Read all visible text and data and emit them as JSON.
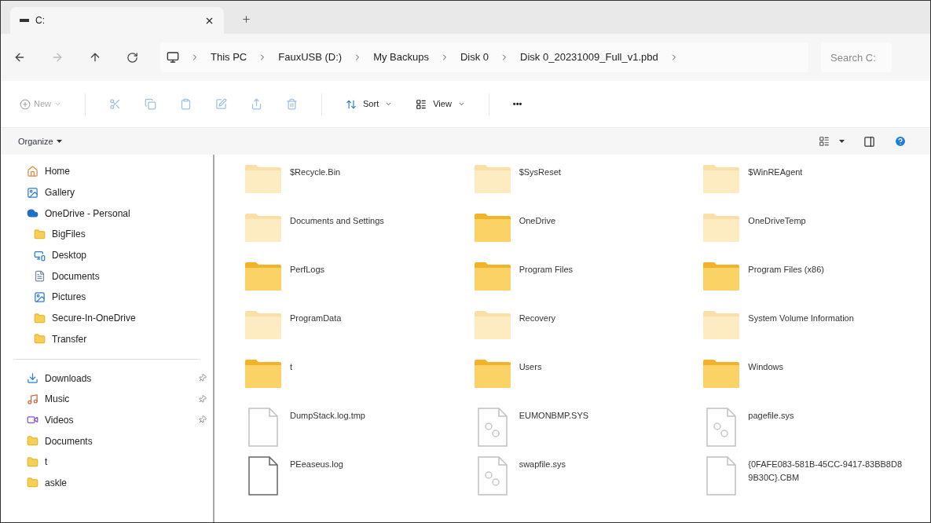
{
  "tab": {
    "title": "C:",
    "selected": true
  },
  "address": {
    "crumbs": [
      "This PC",
      "FauxUSB (D:)",
      "My Backups",
      "Disk 0",
      "Disk 0_20231009_Full_v1.pbd"
    ],
    "search_placeholder": "Search C:"
  },
  "toolbar": {
    "new": {
      "label": "New",
      "disabled": true
    },
    "actions": [
      {
        "kind": "cut",
        "disabled": true
      },
      {
        "kind": "copy",
        "disabled": true
      },
      {
        "kind": "paste",
        "disabled": true
      },
      {
        "kind": "rename",
        "disabled": true
      },
      {
        "kind": "share",
        "disabled": true
      },
      {
        "kind": "delete",
        "disabled": true
      }
    ],
    "sort": "Sort",
    "view": "View",
    "more": "•••"
  },
  "organize": "Organize",
  "sidebar": {
    "groups": [
      [
        {
          "label": "Home",
          "kind": "home"
        },
        {
          "label": "Gallery",
          "kind": "gallery"
        },
        {
          "label": "OneDrive - Personal",
          "kind": "cloud",
          "children": [
            {
              "label": "BigFiles",
              "kind": "folder"
            },
            {
              "label": "Desktop",
              "kind": "desktop"
            },
            {
              "label": "Documents",
              "kind": "documents"
            },
            {
              "label": "Pictures",
              "kind": "gallery"
            },
            {
              "label": "Secure-In-OneDrive",
              "kind": "folder"
            },
            {
              "label": "Transfer",
              "kind": "folder"
            }
          ]
        }
      ],
      [
        {
          "label": "Downloads",
          "kind": "download",
          "pinned": true
        },
        {
          "label": "Music",
          "kind": "music",
          "pinned": true
        },
        {
          "label": "Videos",
          "kind": "video",
          "pinned": true
        },
        {
          "label": "Documents",
          "kind": "folder",
          "pinned": false
        },
        {
          "label": "t",
          "kind": "folder",
          "pinned": false
        },
        {
          "label": "askle",
          "kind": "folder",
          "pinned": false
        }
      ]
    ]
  },
  "items": [
    {
      "name": "$Recycle.Bin",
      "kind": "folder",
      "hidden": true
    },
    {
      "name": "$SysReset",
      "kind": "folder",
      "hidden": true
    },
    {
      "name": "$WinREAgent",
      "kind": "folder",
      "hidden": true
    },
    {
      "name": "Documents and Settings",
      "kind": "folder",
      "hidden": true
    },
    {
      "name": "OneDrive",
      "kind": "folder",
      "hidden": false
    },
    {
      "name": "OneDriveTemp",
      "kind": "folder",
      "hidden": true
    },
    {
      "name": "PerfLogs",
      "kind": "folder",
      "hidden": false
    },
    {
      "name": "Program Files",
      "kind": "folder",
      "hidden": false
    },
    {
      "name": "Program Files (x86)",
      "kind": "folder",
      "hidden": false
    },
    {
      "name": "ProgramData",
      "kind": "folder",
      "hidden": true
    },
    {
      "name": "Recovery",
      "kind": "folder",
      "hidden": true
    },
    {
      "name": "System Volume Information",
      "kind": "folder",
      "hidden": true
    },
    {
      "name": "t",
      "kind": "folder",
      "hidden": false
    },
    {
      "name": "Users",
      "kind": "folder",
      "hidden": false
    },
    {
      "name": "Windows",
      "kind": "folder",
      "hidden": false
    },
    {
      "name": "DumpStack.log.tmp",
      "kind": "file",
      "hidden": true
    },
    {
      "name": "EUMONBMP.SYS",
      "kind": "system",
      "hidden": true
    },
    {
      "name": "pagefile.sys",
      "kind": "system",
      "hidden": true
    },
    {
      "name": "PEeaseus.log",
      "kind": "file",
      "hidden": false
    },
    {
      "name": "swapfile.sys",
      "kind": "system",
      "hidden": true
    },
    {
      "name": "{0FAFE083-581B-45CC-9417-83BB8D89B30C}.CBM",
      "kind": "file",
      "hidden": true
    }
  ]
}
